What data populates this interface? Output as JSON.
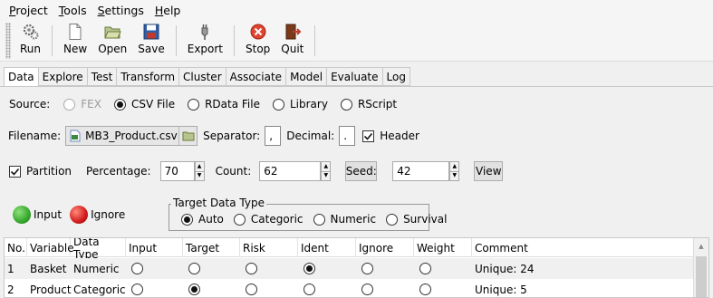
{
  "menu": [
    {
      "first": "P",
      "rest": "roject"
    },
    {
      "first": "T",
      "rest": "ools"
    },
    {
      "first": "S",
      "rest": "ettings"
    },
    {
      "first": "H",
      "rest": "elp"
    }
  ],
  "toolbar": {
    "run": "Run",
    "new": "New",
    "open": "Open",
    "save": "Save",
    "export": "Export",
    "stop": "Stop",
    "quit": "Quit"
  },
  "tabs": [
    "Data",
    "Explore",
    "Test",
    "Transform",
    "Cluster",
    "Associate",
    "Model",
    "Evaluate",
    "Log"
  ],
  "active_tab": "Data",
  "source": {
    "label": "Source:",
    "options": [
      "FEX",
      "CSV File",
      "RData File",
      "Library",
      "RScript"
    ],
    "selected": "CSV File",
    "disabled": [
      "FEX"
    ]
  },
  "file": {
    "filename_label": "Filename:",
    "filename": "MB3_Product.csv",
    "separator_label": "Separator:",
    "separator": ",",
    "decimal_label": "Decimal:",
    "decimal": ".",
    "header_label": "Header",
    "header_checked": true
  },
  "partition": {
    "partition_label": "Partition",
    "partition_checked": true,
    "percentage_label": "Percentage:",
    "percentage": "70",
    "count_label": "Count:",
    "count": "62",
    "seed_button": "Seed:",
    "seed": "42",
    "view_button": "View"
  },
  "legend": {
    "input_label": "Input",
    "ignore_label": "Ignore",
    "input_color": "#35a82d",
    "ignore_color": "#d11b1b"
  },
  "target_type": {
    "title": "Target Data Type",
    "options": [
      "Auto",
      "Categoric",
      "Numeric",
      "Survival"
    ],
    "selected": "Auto"
  },
  "table": {
    "headers": [
      "No.",
      "Variable",
      "Data Type",
      "Input",
      "Target",
      "Risk",
      "Ident",
      "Ignore",
      "Weight",
      "Comment"
    ],
    "rows": [
      {
        "no": "1",
        "variable": "Basket",
        "type": "Numeric",
        "selected_role": "Ident",
        "comment": "Unique: 24"
      },
      {
        "no": "2",
        "variable": "Product",
        "type": "Categoric",
        "selected_role": "Target",
        "comment": "Unique: 5"
      }
    ]
  }
}
